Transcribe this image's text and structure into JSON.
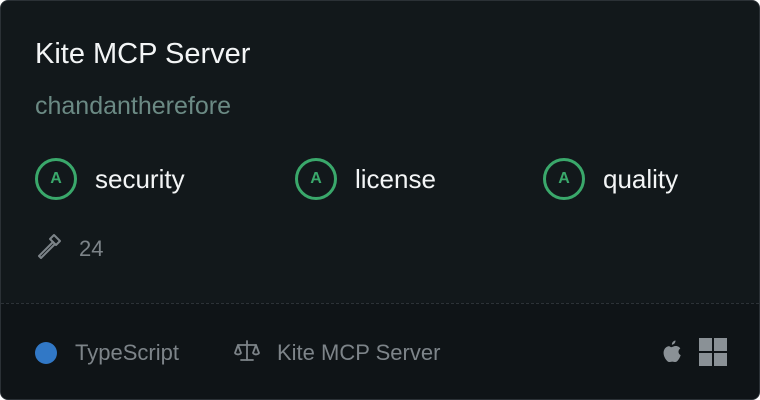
{
  "card": {
    "title": "Kite MCP Server",
    "author": "chandantherefore",
    "scores": [
      {
        "grade": "A",
        "label": "security"
      },
      {
        "grade": "A",
        "label": "license"
      },
      {
        "grade": "A",
        "label": "quality"
      }
    ],
    "tools": {
      "icon": "hammer-icon",
      "count": "24"
    },
    "footer": {
      "language": {
        "name": "TypeScript",
        "color": "#3178c6"
      },
      "license": {
        "icon": "scale-icon",
        "name": "Kite MCP Server"
      },
      "platforms": [
        {
          "icon": "apple-icon"
        },
        {
          "icon": "windows-icon"
        }
      ]
    }
  },
  "colors": {
    "background": "#12181b",
    "grade_accent": "#3aa86b",
    "muted_text": "#7d8489",
    "author_text": "#6b8a84"
  }
}
